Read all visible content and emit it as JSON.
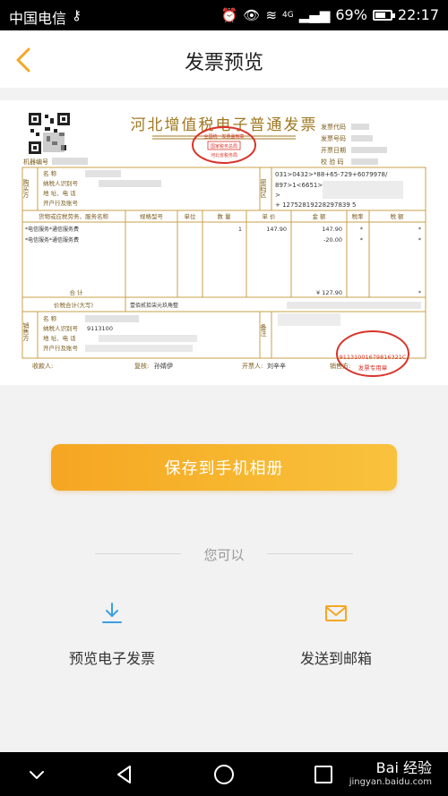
{
  "status_bar": {
    "carrier": "中国电信",
    "network": "4G",
    "battery": "69%",
    "time": "22:17"
  },
  "header": {
    "title": "发票预览",
    "back_icon": "chevron-left-icon"
  },
  "invoice": {
    "title": "河北增值税电子普通发票",
    "seal_top": "全国统一发票监制章",
    "seal_middle": "国家税务总局",
    "seal_bottom": "河北省税务局",
    "meta_labels": [
      "发票代码",
      "发票号码",
      "开票日期",
      "校 验 码"
    ],
    "machine_no_label": "机器编号",
    "buyer_side_label": "购买方",
    "buyer_labels": [
      "名      称",
      "纳税人识别号",
      "地 址、电 话",
      "开户行及账号"
    ],
    "password_side_label": "密码区",
    "password_lines": [
      "031>0432>*88+65-729+6079978/",
      "897>1<6651>0",
      "> ",
      "+ 12752819228297839 5"
    ],
    "columns": [
      "货物或应税劳务、服务名称",
      "规格型号",
      "单位",
      "数 量",
      "单 价",
      "金 额",
      "税率",
      "税 额"
    ],
    "items": [
      {
        "name": "*电信服务*通信服务费",
        "qty": "1",
        "price": "147.90",
        "amount": "147.90",
        "rate": "*",
        "tax": "*"
      },
      {
        "name": "*电信服务*通信服务费",
        "qty": "",
        "price": "",
        "amount": "-20.00",
        "rate": "*",
        "tax": "*"
      }
    ],
    "total_label": "合      计",
    "total_amount": "¥ 127.90",
    "total_tax": "*",
    "price_tax_label": "价税合计(大写)",
    "price_tax_words": "壹佰贰拾柒元玖角整",
    "seller_side_label": "销售方",
    "seller_labels": [
      "名      称",
      "纳税人识别号",
      "地 址、电 话",
      "开户行及账号"
    ],
    "seller_tax_id_partial": "9113100",
    "remark_label": "备注",
    "stamp_code": "91131001679816321C",
    "stamp_bottom": "发票专用章",
    "footer_payee": "收款人:",
    "footer_reviewer": "复核:",
    "footer_reviewer_name": "孙婧伊",
    "footer_issuer": "开票人:",
    "footer_issuer_name": "刘辛辛",
    "footer_seller": "销售方:"
  },
  "actions": {
    "save_label": "保存到手机相册",
    "you_can": "您可以",
    "preview_label": "预览电子发票",
    "email_label": "发送到邮箱",
    "preview_icon": "download-icon",
    "email_icon": "mail-icon"
  },
  "nav": {
    "watermark_main": "Bai 经验",
    "watermark_sub": "jingyan.baidu.com"
  },
  "colors": {
    "accent": "#f5a623",
    "invoice_line": "#c9a24a",
    "seal_red": "#d9342b"
  }
}
